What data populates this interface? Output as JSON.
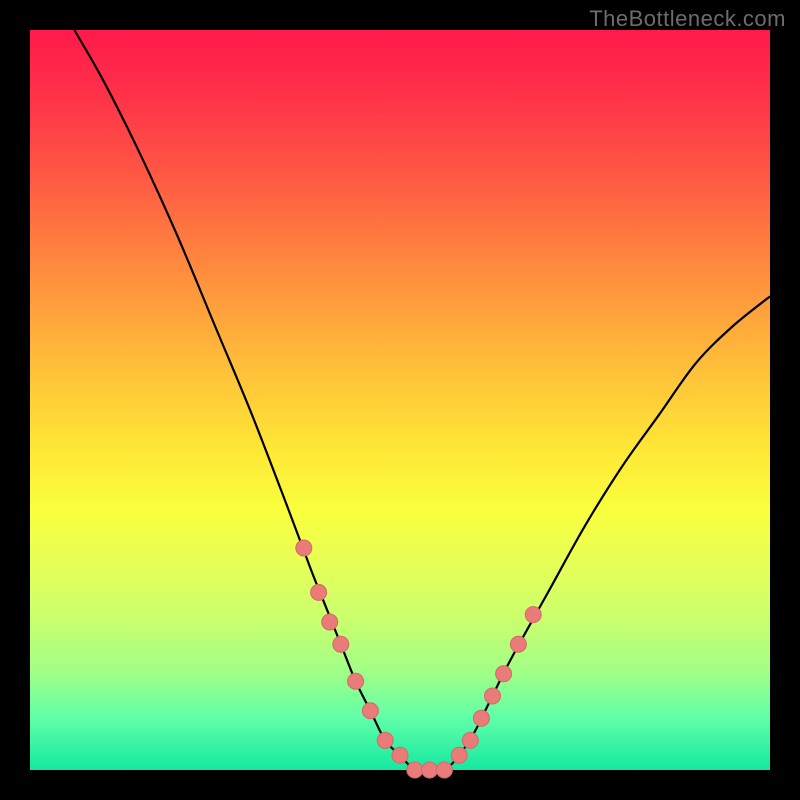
{
  "watermark": "TheBottleneck.com",
  "colors": {
    "marker_fill": "#e97b78",
    "marker_stroke": "#d36a67",
    "curve": "#000000",
    "frame": "#000000"
  },
  "chart_data": {
    "type": "line",
    "title": "",
    "xlabel": "",
    "ylabel": "",
    "xlim": [
      0,
      100
    ],
    "ylim": [
      0,
      100
    ],
    "grid": false,
    "legend": false,
    "series": [
      {
        "name": "curve",
        "x": [
          6,
          10,
          15,
          20,
          25,
          30,
          35,
          38,
          40,
          42,
          44,
          46,
          48,
          50,
          52,
          54,
          56,
          58,
          60,
          62,
          65,
          70,
          75,
          80,
          85,
          90,
          95,
          100
        ],
        "y": [
          100,
          93,
          83,
          72,
          60,
          48,
          35,
          27,
          22,
          17,
          12,
          8,
          4,
          2,
          0,
          0,
          0,
          2,
          5,
          9,
          15,
          24,
          33,
          41,
          48,
          55,
          60,
          64
        ]
      }
    ],
    "markers": {
      "name": "highlighted-points",
      "x": [
        37,
        39,
        40.5,
        42,
        44,
        46,
        48,
        50,
        52,
        54,
        56,
        58,
        59.5,
        61,
        62.5,
        64,
        66,
        68
      ],
      "y": [
        30,
        24,
        20,
        17,
        12,
        8,
        4,
        2,
        0,
        0,
        0,
        2,
        4,
        7,
        10,
        13,
        17,
        21
      ]
    },
    "bottom_bands": [
      {
        "y": 5,
        "color": "#8fff92"
      },
      {
        "y": 4,
        "color": "#6dffa0"
      },
      {
        "y": 3,
        "color": "#3ff2a7"
      },
      {
        "y": 2,
        "color": "#1be8a3"
      },
      {
        "y": 1,
        "color": "#18e3a1"
      }
    ],
    "gradient_stops": [
      {
        "pct": 0,
        "color": "#ff1a4b"
      },
      {
        "pct": 50,
        "color": "#ffe536"
      },
      {
        "pct": 100,
        "color": "#15e8a0"
      }
    ]
  }
}
